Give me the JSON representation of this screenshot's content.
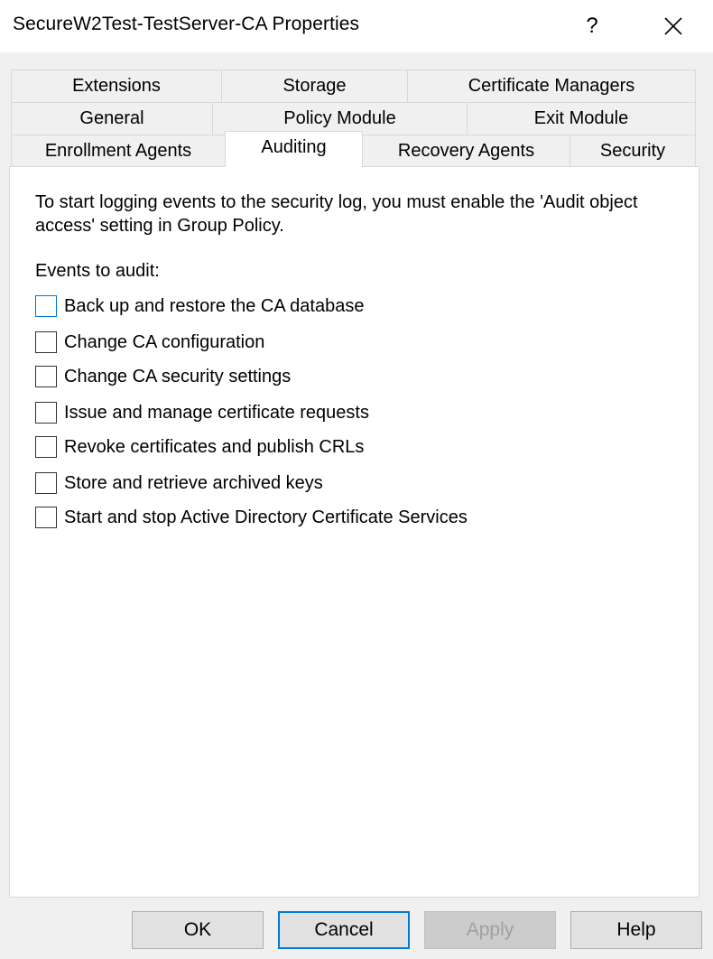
{
  "window": {
    "title": "SecureW2Test-TestServer-CA Properties",
    "help_symbol": "?"
  },
  "tabs": {
    "row1": [
      "Extensions",
      "Storage",
      "Certificate Managers"
    ],
    "row2": [
      "General",
      "Policy Module",
      "Exit Module"
    ],
    "row3": [
      "Enrollment Agents",
      "Auditing",
      "Recovery Agents",
      "Security"
    ],
    "active": "Auditing"
  },
  "auditing": {
    "intro": "To start logging events to the security log, you must enable the 'Audit object access' setting in Group Policy.",
    "events_label": "Events to audit:",
    "events": [
      {
        "label": "Back up and restore the CA database",
        "checked": false
      },
      {
        "label": "Change CA configuration",
        "checked": false
      },
      {
        "label": "Change CA security settings",
        "checked": false
      },
      {
        "label": "Issue and manage certificate requests",
        "checked": false
      },
      {
        "label": "Revoke certificates and publish CRLs",
        "checked": false
      },
      {
        "label": "Store and retrieve archived keys",
        "checked": false
      },
      {
        "label": "Start and stop Active Directory Certificate Services",
        "checked": false
      }
    ]
  },
  "buttons": {
    "ok": "OK",
    "cancel": "Cancel",
    "apply": "Apply",
    "help": "Help"
  },
  "colors": {
    "accent": "#0078d7",
    "dialog_bg": "#f0f0f0",
    "panel_bg": "#ffffff"
  }
}
